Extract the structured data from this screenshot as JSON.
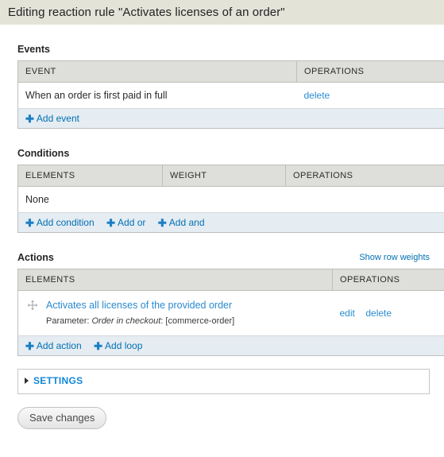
{
  "header": {
    "title": "Editing reaction rule \"Activates licenses of an order\""
  },
  "events": {
    "section_title": "Events",
    "columns": [
      "EVENT",
      "OPERATIONS"
    ],
    "rows": [
      {
        "event": "When an order is first paid in full",
        "operations": [
          "delete"
        ]
      }
    ],
    "add_links": [
      {
        "label": "Add event",
        "icon": "plus-icon"
      }
    ]
  },
  "conditions": {
    "section_title": "Conditions",
    "columns": [
      "ELEMENTS",
      "WEIGHT",
      "OPERATIONS"
    ],
    "empty_text": "None",
    "add_links": [
      {
        "label": "Add condition",
        "icon": "plus-icon"
      },
      {
        "label": "Add or",
        "icon": "plus-icon"
      },
      {
        "label": "Add and",
        "icon": "plus-icon"
      }
    ]
  },
  "actions": {
    "section_title": "Actions",
    "show_row_weights": "Show row weights",
    "columns": [
      "ELEMENTS",
      "OPERATIONS"
    ],
    "rows": [
      {
        "drag_icon": "drag-move-icon",
        "label": "Activates all licenses of the provided order",
        "param_prefix": "Parameter: ",
        "param_name": "Order in checkout",
        "param_value": ": [commerce-order]",
        "operations": [
          "edit",
          "delete"
        ]
      }
    ],
    "add_links": [
      {
        "label": "Add action",
        "icon": "plus-icon"
      },
      {
        "label": "Add loop",
        "icon": "plus-icon"
      }
    ]
  },
  "settings": {
    "legend": "SETTINGS",
    "icon": "triangle-right-icon",
    "collapsed": true
  },
  "form_actions": {
    "save_label": "Save changes"
  },
  "colors": {
    "header_bar": "#e4e3d8",
    "table_header": "#dededa",
    "add_row": "#e5ecf2",
    "link": "#2b8bd1",
    "link_dark": "#0071b3",
    "settings_label": "#1287d8",
    "border": "#bebebe"
  }
}
